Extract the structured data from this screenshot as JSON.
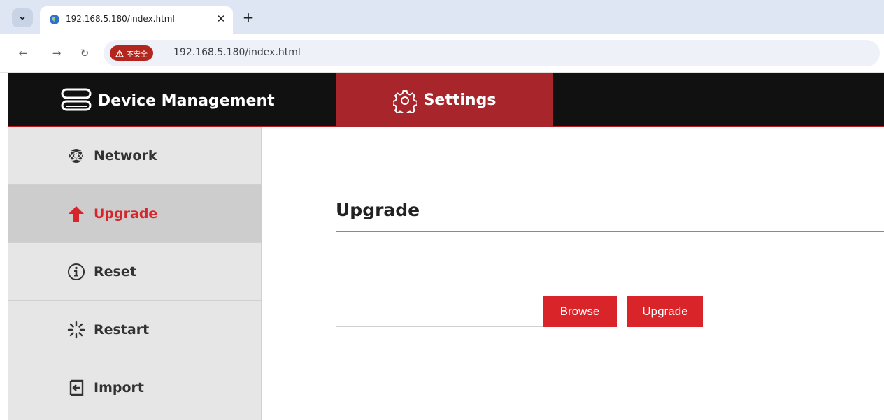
{
  "browser": {
    "tab_title": "192.168.5.180/index.html",
    "security_label": "不安全",
    "url": "192.168.5.180/index.html"
  },
  "header": {
    "brand": "Device Management",
    "active_tab": "Settings"
  },
  "sidebar": {
    "items": [
      {
        "label": "Network",
        "icon": "globe-icon"
      },
      {
        "label": "Upgrade",
        "icon": "arrow-up-icon",
        "active": true
      },
      {
        "label": "Reset",
        "icon": "info-icon"
      },
      {
        "label": "Restart",
        "icon": "spinner-icon"
      },
      {
        "label": "Import",
        "icon": "import-icon"
      }
    ]
  },
  "main": {
    "title": "Upgrade",
    "file_value": "",
    "browse_label": "Browse",
    "upgrade_label": "Upgrade"
  },
  "colors": {
    "accent": "#d92429",
    "header_bg": "#111111",
    "active_tab_bg": "#a8252b",
    "sidebar_bg": "#e6e6e6"
  }
}
